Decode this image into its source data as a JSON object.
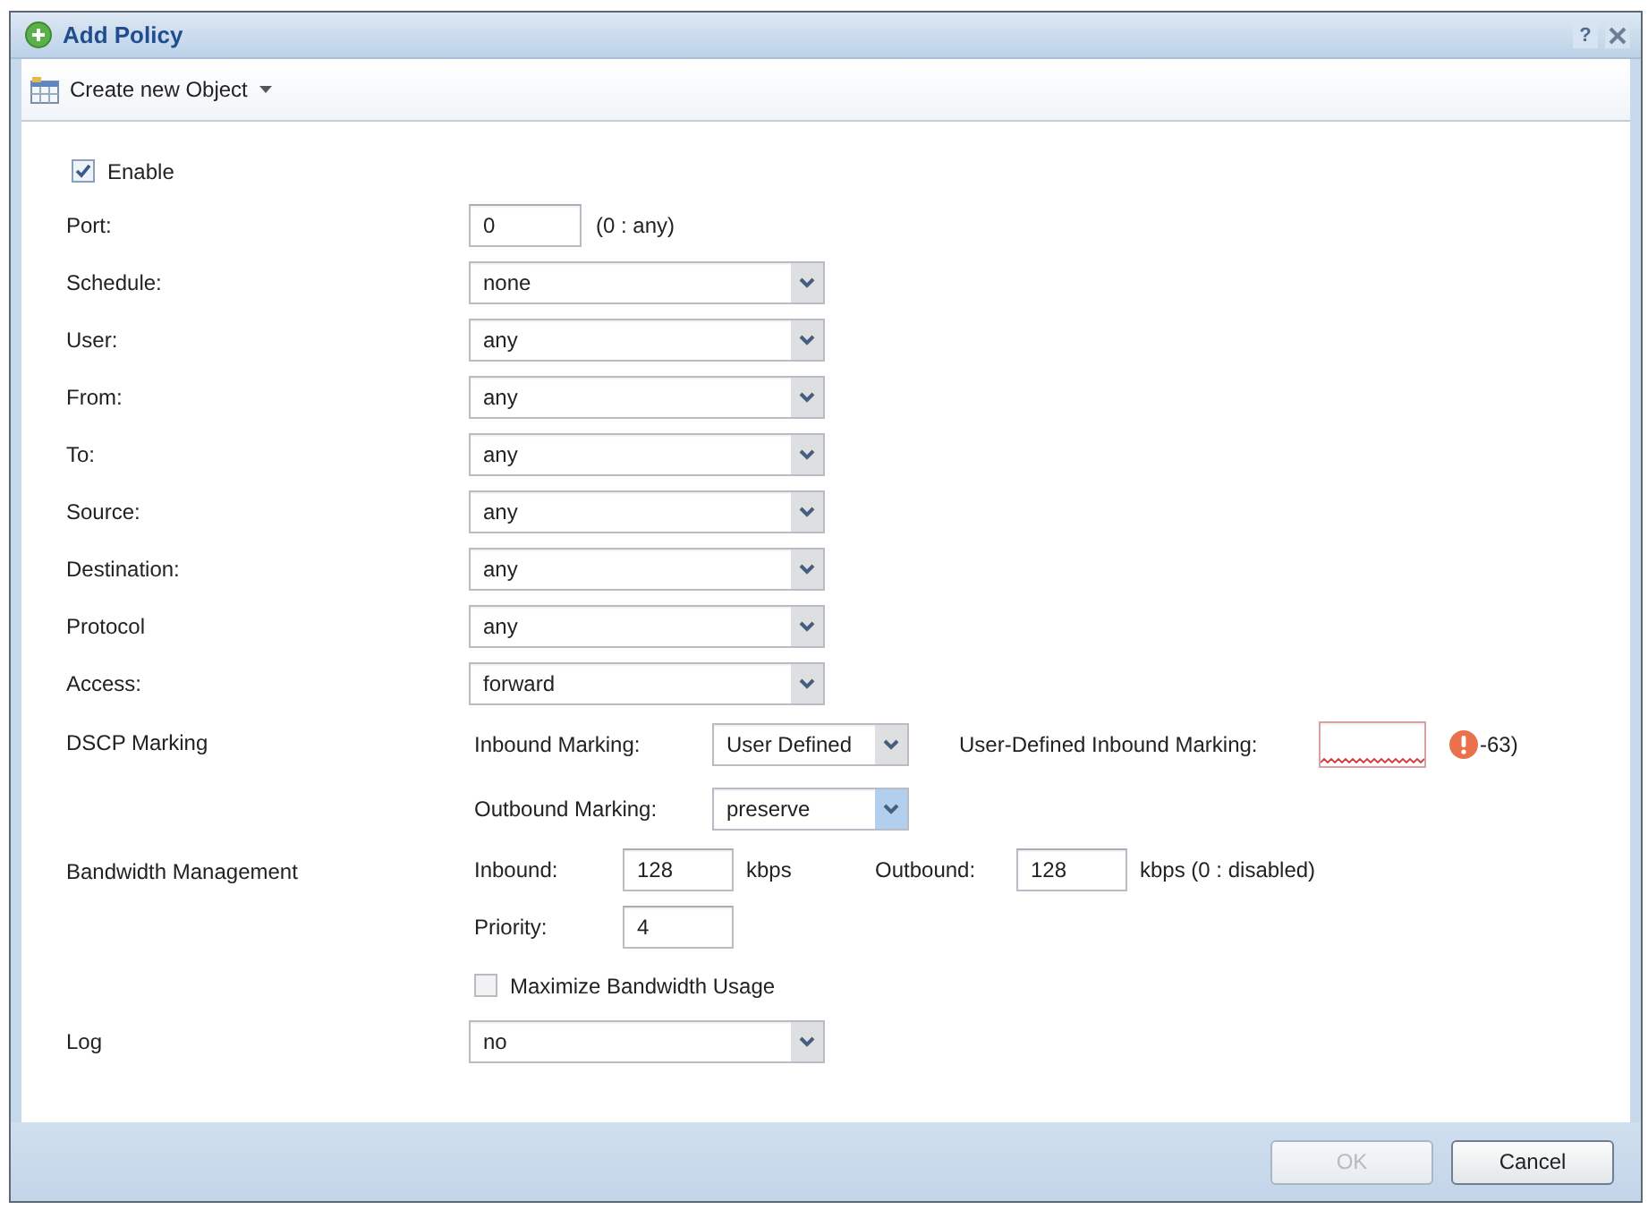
{
  "dialog": {
    "title": "Add Policy",
    "help": "?"
  },
  "toolbar": {
    "create_menu": "Create new Object"
  },
  "enable": {
    "label": "Enable",
    "checked": true
  },
  "fields": [
    {
      "kind": "input",
      "label": "Port:",
      "value": "0",
      "note": "(0 : any)"
    },
    {
      "kind": "select",
      "label": "Schedule:",
      "value": "none"
    },
    {
      "kind": "select",
      "label": "User:",
      "value": "any"
    },
    {
      "kind": "select",
      "label": "From:",
      "value": "any"
    },
    {
      "kind": "select",
      "label": "To:",
      "value": "any"
    },
    {
      "kind": "select",
      "label": "Source:",
      "value": "any"
    },
    {
      "kind": "select",
      "label": "Destination:",
      "value": "any"
    },
    {
      "kind": "select",
      "label": "Protocol",
      "value": "any"
    },
    {
      "kind": "select",
      "label": "Access:",
      "value": "forward"
    }
  ],
  "dscp": {
    "label": "DSCP Marking",
    "inbound": {
      "label": "Inbound Marking:",
      "value": "User Defined",
      "active": false
    },
    "user_defined": {
      "label": "User-Defined Inbound Marking:",
      "invalid": true,
      "note": "-63)"
    },
    "outbound": {
      "label": "Outbound Marking:",
      "value": "preserve",
      "active": true
    }
  },
  "bandwidth": {
    "label": "Bandwidth Management",
    "inbound": {
      "label": "Inbound:",
      "value": "128",
      "unit": "kbps"
    },
    "outbound": {
      "label": "Outbound:",
      "value": "128",
      "unit": "kbps (0 : disabled)"
    },
    "priority": {
      "label": "Priority:",
      "value": "4"
    },
    "maximize": {
      "label": "Maximize Bandwidth Usage",
      "checked": false
    }
  },
  "log": {
    "label": "Log",
    "value": "no"
  },
  "buttons": [
    {
      "label": "OK",
      "disabled": true
    },
    {
      "label": "Cancel",
      "disabled": false
    }
  ]
}
